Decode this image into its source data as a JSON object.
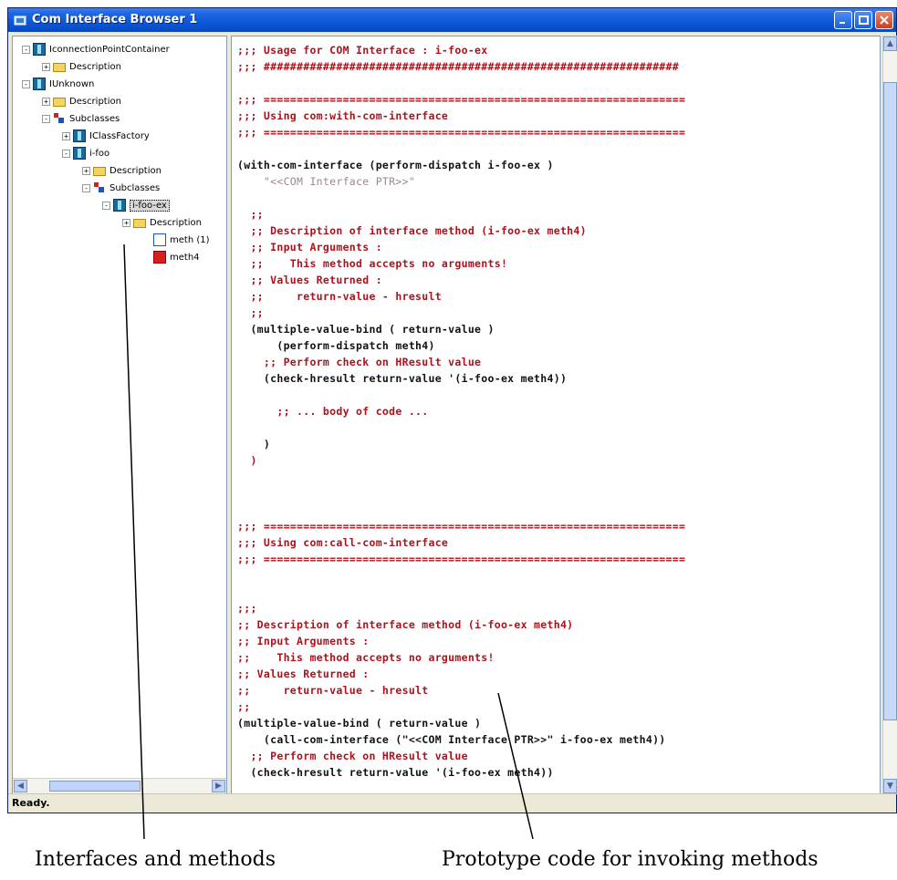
{
  "window": {
    "title": "Com Interface Browser 1",
    "status": "Ready."
  },
  "tree": {
    "items": [
      {
        "label": "IconnectionPointContainer",
        "icon": "interface-icon",
        "toggle": "-"
      },
      {
        "label": "Description",
        "icon": "folder-icon",
        "toggle": "+"
      },
      {
        "label": "IUnknown",
        "icon": "interface-icon",
        "toggle": "-"
      },
      {
        "label": "Description",
        "icon": "folder-icon",
        "toggle": "+"
      },
      {
        "label": "Subclasses",
        "icon": "subclasses-icon",
        "toggle": "-"
      },
      {
        "label": "IClassFactory",
        "icon": "interface-icon",
        "toggle": "+"
      },
      {
        "label": "i-foo",
        "icon": "interface-icon",
        "toggle": "-"
      },
      {
        "label": "Description",
        "icon": "folder-icon",
        "toggle": "+"
      },
      {
        "label": "Subclasses",
        "icon": "subclasses-icon",
        "toggle": "-"
      },
      {
        "label": "i-foo-ex",
        "icon": "interface-icon",
        "toggle": "-"
      },
      {
        "label": "Description",
        "icon": "folder-icon",
        "toggle": "+"
      },
      {
        "label": "meth (1)",
        "icon": "method-icon",
        "toggle": ""
      },
      {
        "label": "meth4",
        "icon": "method-red-icon",
        "toggle": ""
      }
    ]
  },
  "code": {
    "lines": [
      {
        "text": ";;; Usage for COM Interface : i-foo-ex",
        "color": "red"
      },
      {
        "text": ";;; ###############################################################",
        "color": "red"
      },
      {
        "text": "",
        "color": "red"
      },
      {
        "text": ";;; ================================================================",
        "color": "red"
      },
      {
        "text": ";;; Using com:with-com-interface",
        "color": "red"
      },
      {
        "text": ";;; ================================================================",
        "color": "red"
      },
      {
        "text": "",
        "color": "red"
      },
      {
        "text": "(with-com-interface (perform-dispatch i-foo-ex )",
        "color": "black"
      },
      {
        "text": "    \"<<COM Interface PTR>>\"",
        "color": "grey"
      },
      {
        "text": "",
        "color": "red"
      },
      {
        "text": "  ;;",
        "color": "red"
      },
      {
        "text": "  ;; Description of interface method (i-foo-ex meth4)",
        "color": "red"
      },
      {
        "text": "  ;; Input Arguments :",
        "color": "red"
      },
      {
        "text": "  ;;    This method accepts no arguments!",
        "color": "red"
      },
      {
        "text": "  ;; Values Returned :",
        "color": "red"
      },
      {
        "text": "  ;;     return-value - hresult",
        "color": "red"
      },
      {
        "text": "  ;;",
        "color": "red"
      },
      {
        "text": "  (multiple-value-bind ( return-value )",
        "color": "black"
      },
      {
        "text": "      (perform-dispatch meth4)",
        "color": "black"
      },
      {
        "text": "    ;; Perform check on HResult value",
        "color": "red"
      },
      {
        "text": "    (check-hresult return-value '(i-foo-ex meth4))",
        "color": "black"
      },
      {
        "text": "",
        "color": "red"
      },
      {
        "text": "      ;; ... body of code ...",
        "color": "red"
      },
      {
        "text": "",
        "color": "red"
      },
      {
        "text": "    )",
        "color": "black"
      },
      {
        "text": "  )",
        "color": "red"
      },
      {
        "text": "",
        "color": "red"
      },
      {
        "text": "",
        "color": "red"
      },
      {
        "text": "",
        "color": "red"
      },
      {
        "text": ";;; ================================================================",
        "color": "red"
      },
      {
        "text": ";;; Using com:call-com-interface",
        "color": "red"
      },
      {
        "text": ";;; ================================================================",
        "color": "red"
      },
      {
        "text": "",
        "color": "red"
      },
      {
        "text": "",
        "color": "red"
      },
      {
        "text": ";;;",
        "color": "red"
      },
      {
        "text": ";; Description of interface method (i-foo-ex meth4)",
        "color": "red"
      },
      {
        "text": ";; Input Arguments :",
        "color": "red"
      },
      {
        "text": ";;    This method accepts no arguments!",
        "color": "red"
      },
      {
        "text": ";; Values Returned :",
        "color": "red"
      },
      {
        "text": ";;     return-value - hresult",
        "color": "red"
      },
      {
        "text": ";;",
        "color": "red"
      },
      {
        "text": "(multiple-value-bind ( return-value )",
        "color": "black"
      },
      {
        "text": "    (call-com-interface (\"<<COM Interface PTR>>\" i-foo-ex meth4))",
        "color": "black"
      },
      {
        "text": "  ;; Perform check on HResult value",
        "color": "red"
      },
      {
        "text": "  (check-hresult return-value '(i-foo-ex meth4))",
        "color": "black"
      }
    ]
  },
  "captions": {
    "left": "Interfaces and methods",
    "right": "Prototype code for invoking methods"
  },
  "colors": {
    "code_comment": "#b0101a",
    "code_text": "#111111",
    "code_string": "#9a8a8a",
    "titlebar": "#0a58d8"
  }
}
